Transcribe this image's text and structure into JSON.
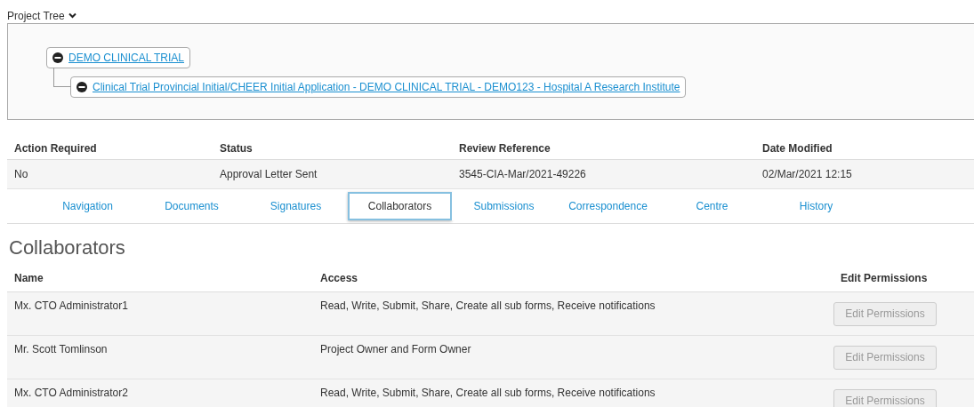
{
  "project_tree": {
    "label": "Project Tree",
    "expanded": true,
    "nodes": [
      {
        "label": "DEMO CLINICAL TRIAL",
        "expanded": true,
        "children": [
          {
            "label": "Clinical Trial Provincial Initial/CHEER Initial Application - DEMO CLINICAL TRIAL - DEMO123 - Hospital A Research Institute",
            "expanded": true
          }
        ]
      }
    ]
  },
  "summary": {
    "columns": [
      "Action Required",
      "Status",
      "Review Reference",
      "Date Modified"
    ],
    "rows": [
      [
        "No",
        "Approval Letter Sent",
        "3545-CIA-Mar/2021-49226",
        "02/Mar/2021 12:15"
      ]
    ]
  },
  "tabs": [
    {
      "label": "Navigation",
      "selected": false
    },
    {
      "label": "Documents",
      "selected": false
    },
    {
      "label": "Signatures",
      "selected": false
    },
    {
      "label": "Collaborators",
      "selected": true
    },
    {
      "label": "Submissions",
      "selected": false
    },
    {
      "label": "Correspondence",
      "selected": false
    },
    {
      "label": "Centre",
      "selected": false
    },
    {
      "label": "History",
      "selected": false
    }
  ],
  "collaborators": {
    "title": "Collaborators",
    "columns": [
      "Name",
      "Access",
      "Edit Permissions"
    ],
    "rows": [
      {
        "name": "Mx. CTO Administrator1",
        "access": "Read, Write, Submit, Share, Create all sub forms, Receive notifications",
        "button": "Edit Permissions",
        "disabled": true
      },
      {
        "name": "Mr. Scott Tomlinson",
        "access": "Project Owner and Form Owner",
        "button": "Edit Permissions",
        "disabled": true
      },
      {
        "name": "Mx. CTO Administrator2",
        "access": "Read, Write, Submit, Share, Create all sub forms, Receive notifications",
        "button": "Edit Permissions",
        "disabled": true
      }
    ]
  }
}
